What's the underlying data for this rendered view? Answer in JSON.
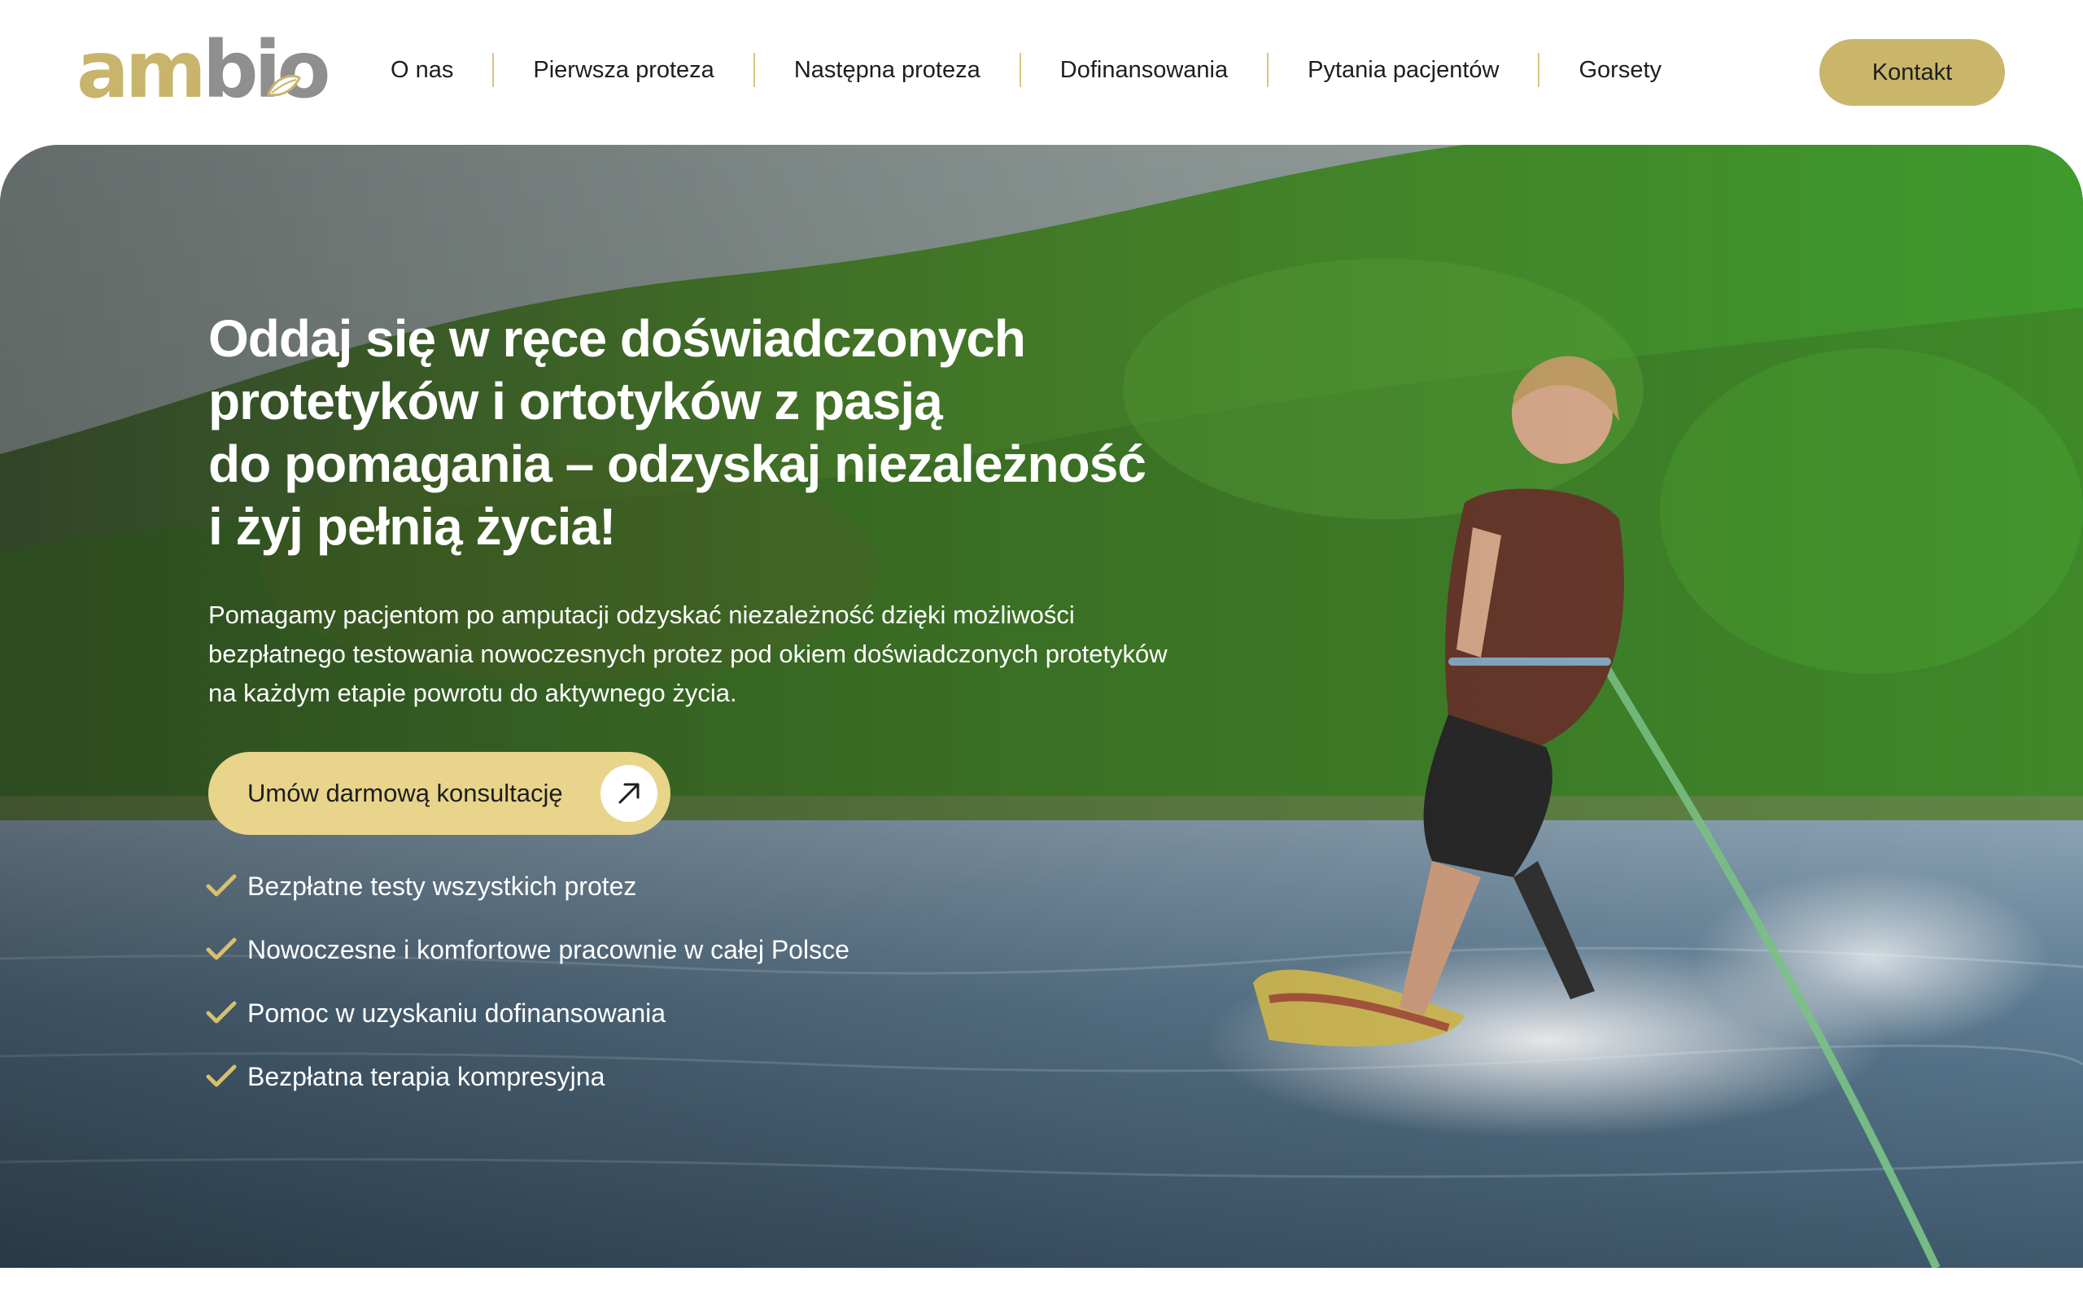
{
  "brand": {
    "logo_part1": "am",
    "logo_part2": "bio",
    "primary_color": "#c9b66a",
    "secondary_color": "#8f8f8f"
  },
  "nav": {
    "items": [
      {
        "label": "O nas"
      },
      {
        "label": "Pierwsza proteza"
      },
      {
        "label": "Następna proteza"
      },
      {
        "label": "Dofinansowania"
      },
      {
        "label": "Pytania pacjentów"
      },
      {
        "label": "Gorsety"
      }
    ],
    "contact_label": "Kontakt"
  },
  "hero": {
    "headline_lines": [
      "Oddaj się w ręce doświadczonych",
      "protetyków i ortotyków z pasją",
      "do pomagania – odzyskaj niezależność",
      "i żyj pełnią życia!"
    ],
    "lead": "Pomagamy pacjentom po amputacji odzyskać niezależność dzięki możliwości bezpłatnego testowania nowoczesnych protez pod okiem doświadczonych protetyków na każdym etapie powrotu do aktywnego życia.",
    "cta_label": "Umów darmową konsultację",
    "cta_icon": "arrow-up-right-icon",
    "cta_color": "#e8d48a",
    "features": [
      {
        "label": "Bezpłatne testy wszystkich protez",
        "icon": "check-icon"
      },
      {
        "label": "Nowoczesne i komfortowe pracownie w całej Polsce",
        "icon": "check-icon"
      },
      {
        "label": "Pomoc w uzyskaniu dofinansowania",
        "icon": "check-icon"
      },
      {
        "label": "Bezpłatna terapia kompresyjna",
        "icon": "check-icon"
      }
    ]
  }
}
